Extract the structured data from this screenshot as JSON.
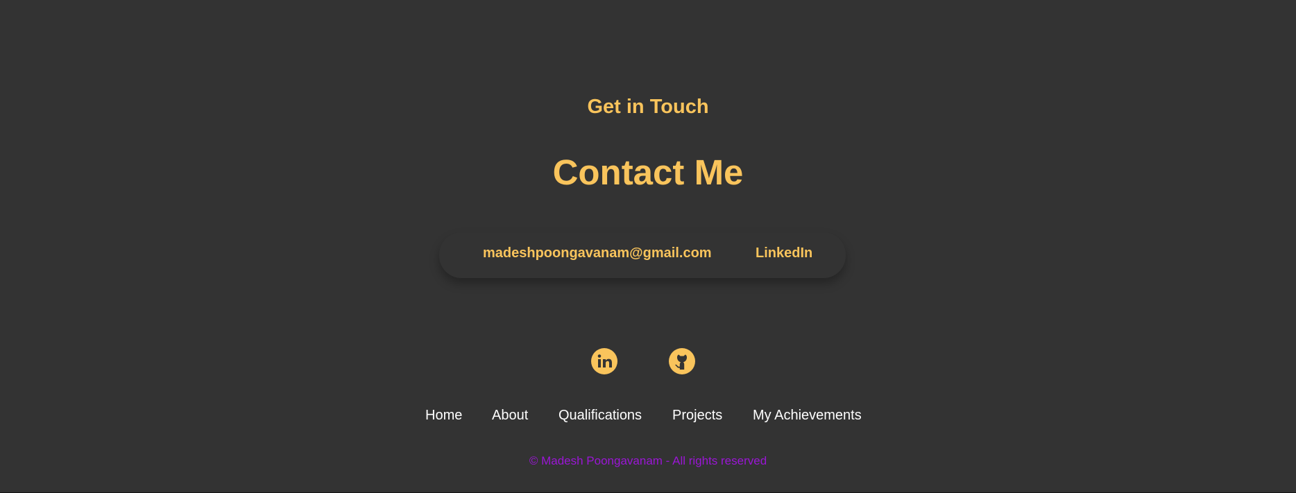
{
  "contact": {
    "subtitle": "Get in Touch",
    "title": "Contact Me",
    "email": "madeshpoongavanam@gmail.com",
    "linkedin_label": "LinkedIn"
  },
  "social": {
    "icons": [
      "linkedin-icon",
      "github-icon"
    ]
  },
  "footer": {
    "nav": [
      {
        "label": "Home"
      },
      {
        "label": "About"
      },
      {
        "label": "Qualifications"
      },
      {
        "label": "Projects"
      },
      {
        "label": "My Achievements"
      }
    ],
    "copyright": "© Madesh Poongavanam - All rights reserved"
  },
  "colors": {
    "background": "#333333",
    "accent": "#f9c45c",
    "nav_text": "#ffffff",
    "copyright": "#9b16d6"
  }
}
